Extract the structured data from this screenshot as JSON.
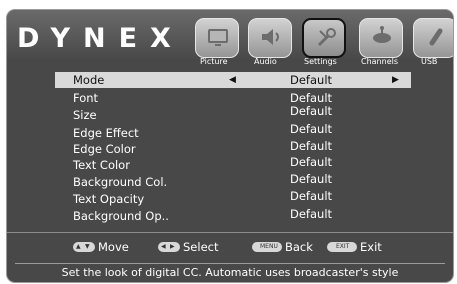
{
  "brand": "DYNEX",
  "tabs": [
    {
      "label": "Picture",
      "icon": "picture-icon",
      "active": false
    },
    {
      "label": "Audio",
      "icon": "audio-icon",
      "active": false
    },
    {
      "label": "Settings",
      "icon": "settings-icon",
      "active": true
    },
    {
      "label": "Channels",
      "icon": "channels-icon",
      "active": false
    },
    {
      "label": "USB",
      "icon": "usb-icon",
      "active": false
    }
  ],
  "menu": {
    "rows": [
      {
        "name": "Mode",
        "value": "Default"
      },
      {
        "name": "Font",
        "value": "Default"
      },
      {
        "name": "Size",
        "value": "Default"
      },
      {
        "name": "Edge Effect",
        "value": "Default"
      },
      {
        "name": "Edge Color",
        "value": "Default"
      },
      {
        "name": "Text Color",
        "value": "Default"
      },
      {
        "name": "Background Col.",
        "value": "Default"
      },
      {
        "name": "Text Opacity",
        "value": "Default"
      },
      {
        "name": "Background Op..",
        "value": "Default"
      }
    ],
    "left_arrow": "◀",
    "right_arrow": "▶"
  },
  "footer": {
    "move": "Move",
    "select": "Select",
    "back": "Back",
    "exit": "Exit",
    "menu_key": "MENU",
    "exit_key": "EXIT",
    "help": "Set the look of digital CC. Automatic uses broadcaster's style"
  }
}
